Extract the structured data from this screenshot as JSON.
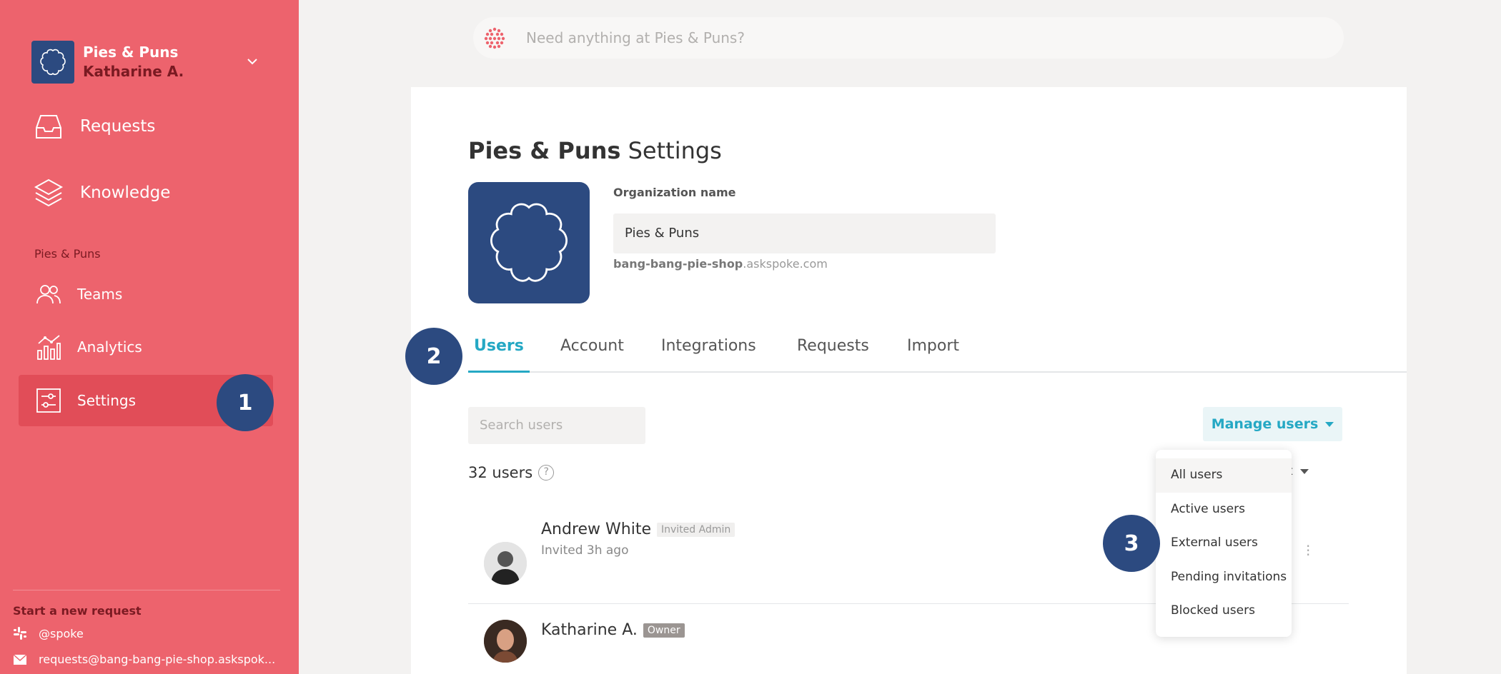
{
  "sidebar": {
    "org_name": "Pies & Puns",
    "org_user": "Katharine A.",
    "nav_main": [
      {
        "label": "Requests",
        "icon": "inbox-icon"
      },
      {
        "label": "Knowledge",
        "icon": "layers-icon"
      }
    ],
    "section_title": "Pies & Puns",
    "nav_sub": [
      {
        "label": "Teams",
        "icon": "people-icon"
      },
      {
        "label": "Analytics",
        "icon": "chart-icon"
      },
      {
        "label": "Settings",
        "icon": "sliders-icon",
        "active": true
      }
    ],
    "footer": {
      "title": "Start a new request",
      "slack": "@spoke",
      "email": "requests@bang-bang-pie-shop.askspok..."
    }
  },
  "search": {
    "placeholder": "Need anything at Pies & Puns?"
  },
  "settings": {
    "title_org": "Pies & Puns",
    "title_suffix": "Settings",
    "org_name_label": "Organization name",
    "org_name_value": "Pies & Puns",
    "subdomain": "bang-bang-pie-shop",
    "domain_suffix": ".askspoke.com",
    "tabs": [
      {
        "label": "Users",
        "active": true
      },
      {
        "label": "Account"
      },
      {
        "label": "Integrations"
      },
      {
        "label": "Requests"
      },
      {
        "label": "Import"
      }
    ],
    "search_users_placeholder": "Search users",
    "manage_users_label": "Manage users",
    "user_count": "32 users",
    "sort_label": "rt",
    "users": [
      {
        "name": "Andrew White",
        "role": "Invited Admin",
        "sub": "Invited 3h ago"
      },
      {
        "name": "Katharine A.",
        "role": "Owner",
        "sub": ""
      }
    ]
  },
  "dropdown": {
    "items": [
      "All users",
      "Active users",
      "External users",
      "Pending invitations",
      "Blocked users"
    ],
    "selected": "All users"
  },
  "badges": [
    "1",
    "2",
    "3"
  ],
  "colors": {
    "sidebar": "#ed636d",
    "sidebar_active": "#e14d58",
    "brand_navy": "#2c4a80",
    "accent_teal": "#25a8c4"
  }
}
